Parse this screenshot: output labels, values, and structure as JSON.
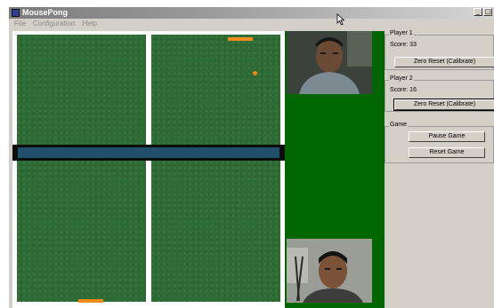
{
  "window": {
    "title": "MousePong"
  },
  "menu": {
    "items": [
      "File",
      "Configuration",
      "Help"
    ]
  },
  "player1": {
    "label": "Player 1",
    "score_text": "Score:  33",
    "button": "Zero Reset (Calibrate)"
  },
  "player2": {
    "label": "Player 2",
    "score_text": "Score:  16",
    "button": "Zero Reset (Calibrate)"
  },
  "game": {
    "label": "Game",
    "pause_button": "Pause Game",
    "reset_button": "Reset Game"
  },
  "icons": {
    "app": "app-icon",
    "cursor": "mouse-cursor-icon"
  },
  "colors": {
    "court": "#2c6b34",
    "paddle": "#f08a1a",
    "camera_bg": "#006600"
  }
}
